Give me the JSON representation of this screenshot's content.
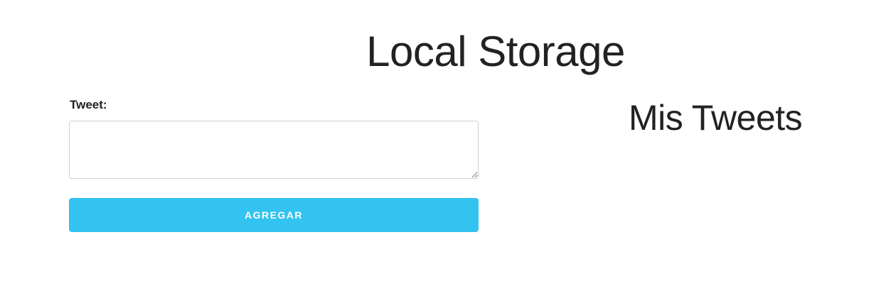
{
  "header": {
    "title": "Local Storage"
  },
  "form": {
    "tweet_label": "Tweet:",
    "tweet_value": "",
    "tweet_placeholder": "",
    "submit_label": "AGREGAR"
  },
  "tweets_panel": {
    "heading": "Mis Tweets",
    "items": []
  },
  "colors": {
    "accent": "#33c3f0",
    "text": "#222222",
    "border": "#d1d1d1",
    "background": "#ffffff"
  }
}
